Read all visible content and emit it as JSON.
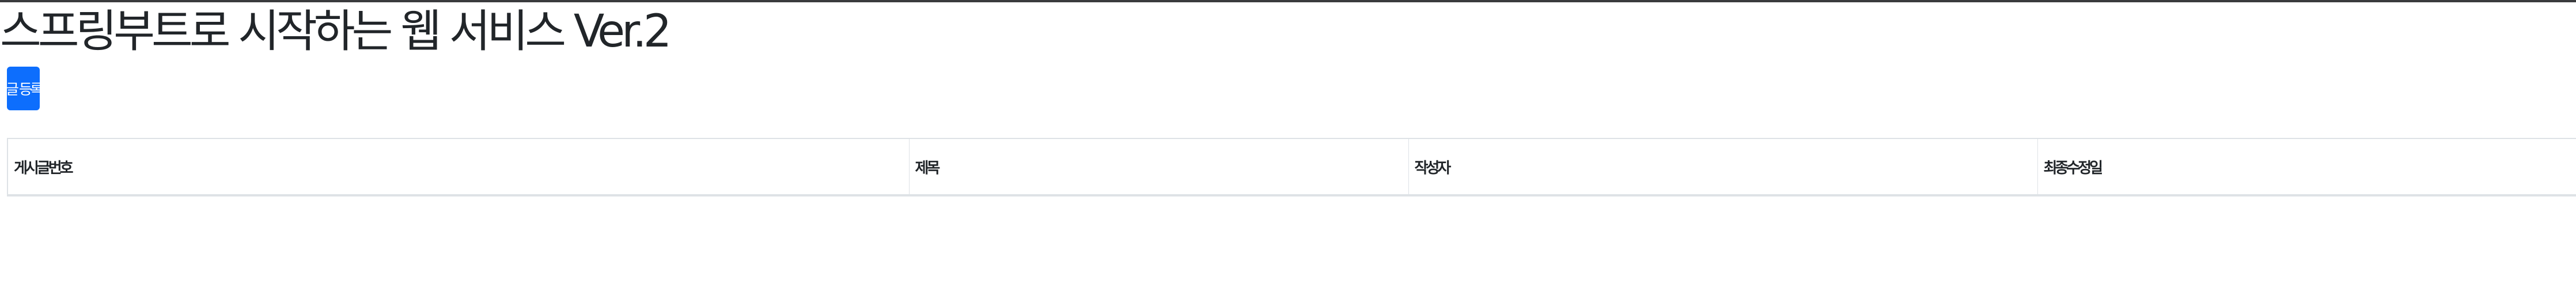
{
  "header": {
    "title": "스프링부트로 시작하는 웹 서비스 Ver.2"
  },
  "toolbar": {
    "register_label": "글 등록",
    "accent_color": "#0d6efd"
  },
  "table": {
    "columns": [
      "게시글번호",
      "제목",
      "작성자",
      "최종수정일"
    ],
    "rows": []
  }
}
